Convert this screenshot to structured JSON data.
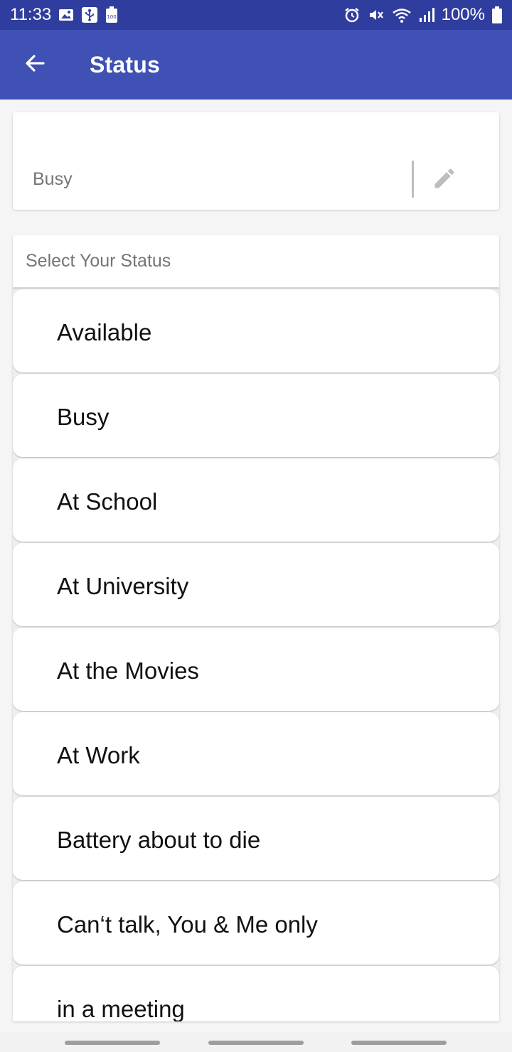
{
  "status_bar": {
    "time": "11:33",
    "battery_text": "100%",
    "left_icons": [
      "image-icon",
      "usb-icon",
      "battery-saver-icon"
    ],
    "right_icons": [
      "alarm-icon",
      "mute-icon",
      "wifi-icon",
      "signal-icon",
      "battery-icon"
    ]
  },
  "app_bar": {
    "title": "Status",
    "background": "#3f51b5",
    "status_bar_background": "#2f3e9e"
  },
  "current_status": {
    "value": "Busy"
  },
  "status_picker": {
    "label": "Select Your Status",
    "items": [
      "Available",
      "Busy",
      "At School",
      "At University",
      "At the Movies",
      "At Work",
      "Battery about to die",
      "Can‘t talk, You & Me only",
      "in a meeting"
    ]
  }
}
